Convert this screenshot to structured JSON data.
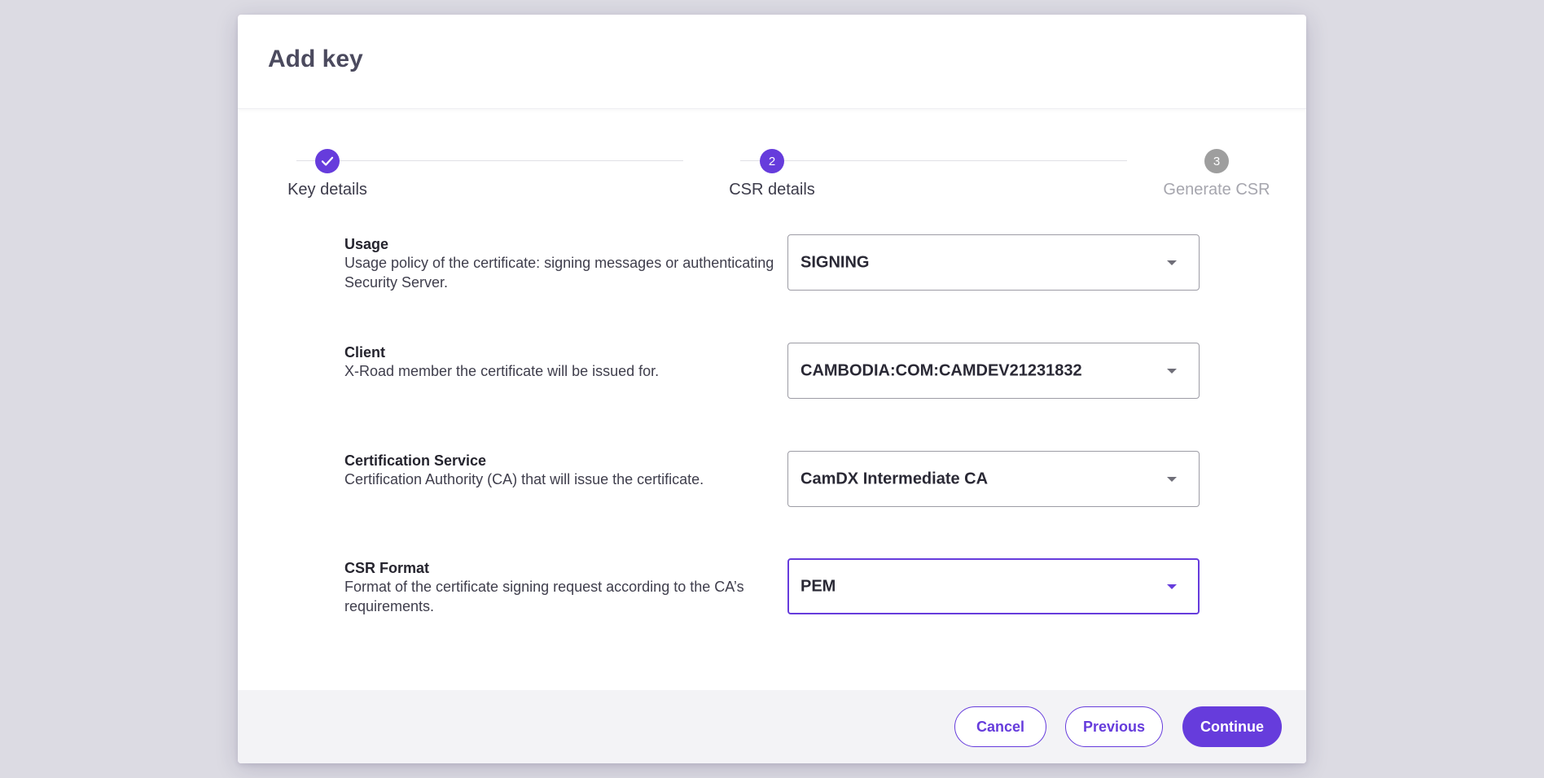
{
  "dialog": {
    "title": "Add key"
  },
  "stepper": {
    "steps": [
      {
        "number": "1",
        "label": "Key details",
        "state": "done"
      },
      {
        "number": "2",
        "label": "CSR details",
        "state": "active"
      },
      {
        "number": "3",
        "label": "Generate CSR",
        "state": "todo"
      }
    ]
  },
  "form": {
    "usage": {
      "label": "Usage",
      "description": "Usage policy of the certificate: signing messages or authenticating Security Server.",
      "value": "SIGNING"
    },
    "client": {
      "label": "Client",
      "description": "X-Road member the certificate will be issued for.",
      "value": "CAMBODIA:COM:CAMDEV21231832"
    },
    "certification_service": {
      "label": "Certification Service",
      "description": "Certification Authority (CA) that will issue the certificate.",
      "value": "CamDX Intermediate CA"
    },
    "csr_format": {
      "label": "CSR Format",
      "description": "Format of the certificate signing request according to the CA’s requirements.",
      "value": "PEM"
    }
  },
  "footer": {
    "cancel_label": "Cancel",
    "previous_label": "Previous",
    "continue_label": "Continue"
  },
  "colors": {
    "accent": "#663cdc",
    "inactive_step": "#9e9e9e",
    "backdrop": "#dcdbe3"
  },
  "icons": {
    "done_step": "check-icon",
    "select_caret": "chevron-down-icon"
  }
}
